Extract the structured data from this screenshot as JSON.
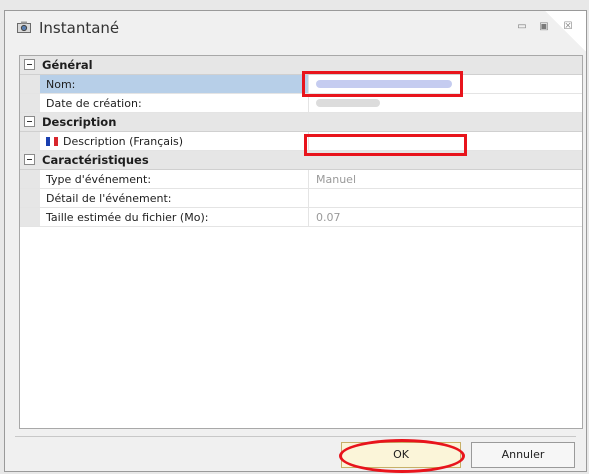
{
  "window": {
    "title": "Instantané",
    "controls": {
      "minimize": "▭",
      "maximize": "▣",
      "close": "☒"
    }
  },
  "categories": [
    {
      "label": "Général",
      "properties": [
        {
          "name": "Nom:",
          "value": "",
          "selected": true
        },
        {
          "name": "Date de création:",
          "value": ""
        }
      ]
    },
    {
      "label": "Description",
      "properties": [
        {
          "name": "Description (Français)",
          "value": "",
          "flag": "fr-flag-icon"
        }
      ]
    },
    {
      "label": "Caractéristiques",
      "properties": [
        {
          "name": "Type d'événement:",
          "value": "Manuel"
        },
        {
          "name": "Détail de l'événement:",
          "value": ""
        },
        {
          "name": "Taille estimée du fichier (Mo):",
          "value": "0.07"
        }
      ]
    }
  ],
  "buttons": {
    "ok": "OK",
    "cancel": "Annuler"
  },
  "colors": {
    "highlight": "#e8141c",
    "selection": "#b7cfe8",
    "ok_button": "#fbf5d9"
  }
}
